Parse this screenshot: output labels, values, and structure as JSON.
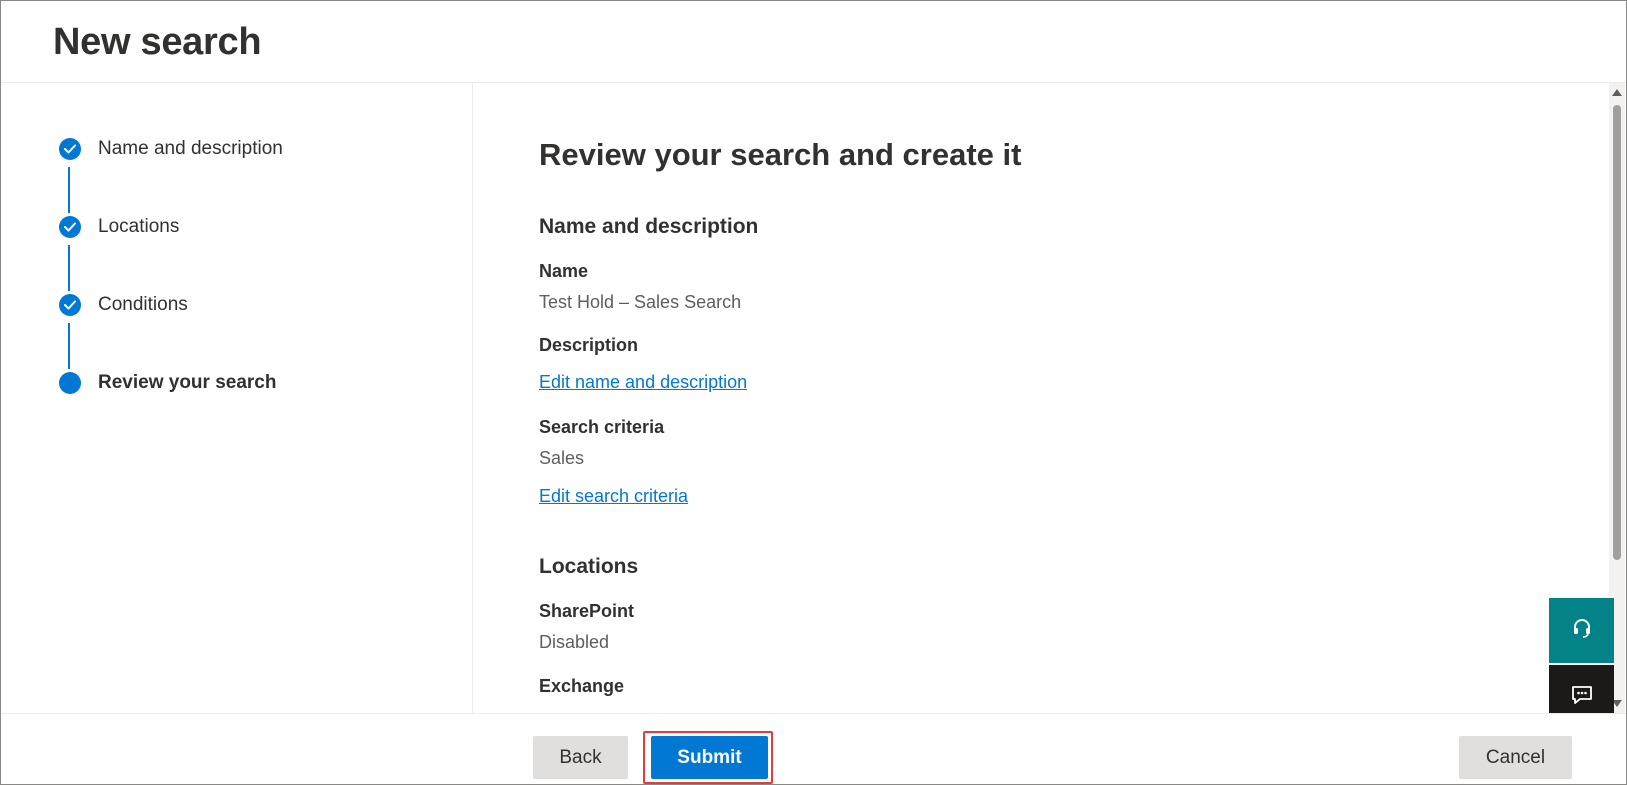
{
  "header": {
    "title": "New search"
  },
  "wizard": {
    "steps": [
      {
        "label": "Name and description",
        "status": "completed"
      },
      {
        "label": "Locations",
        "status": "completed"
      },
      {
        "label": "Conditions",
        "status": "completed"
      },
      {
        "label": "Review your search",
        "status": "current"
      }
    ]
  },
  "review": {
    "title": "Review your search and create it",
    "name_section": {
      "heading": "Name and description",
      "name_label": "Name",
      "name_value": "Test Hold – Sales Search",
      "description_label": "Description",
      "edit_link": "Edit name and description",
      "criteria_label": "Search criteria",
      "criteria_value": "Sales",
      "edit_criteria_link": "Edit search criteria"
    },
    "locations_section": {
      "heading": "Locations",
      "sharepoint_label": "SharePoint",
      "sharepoint_value": "Disabled",
      "exchange_label": "Exchange"
    }
  },
  "footer": {
    "back_label": "Back",
    "submit_label": "Submit",
    "cancel_label": "Cancel"
  },
  "floating": {
    "help_icon": "headset-icon",
    "feedback_icon": "feedback-icon"
  },
  "colors": {
    "accent": "#0078d4",
    "help_button": "#038387",
    "feedback_button": "#1b1a19",
    "highlight_outline": "#e33e3f"
  }
}
